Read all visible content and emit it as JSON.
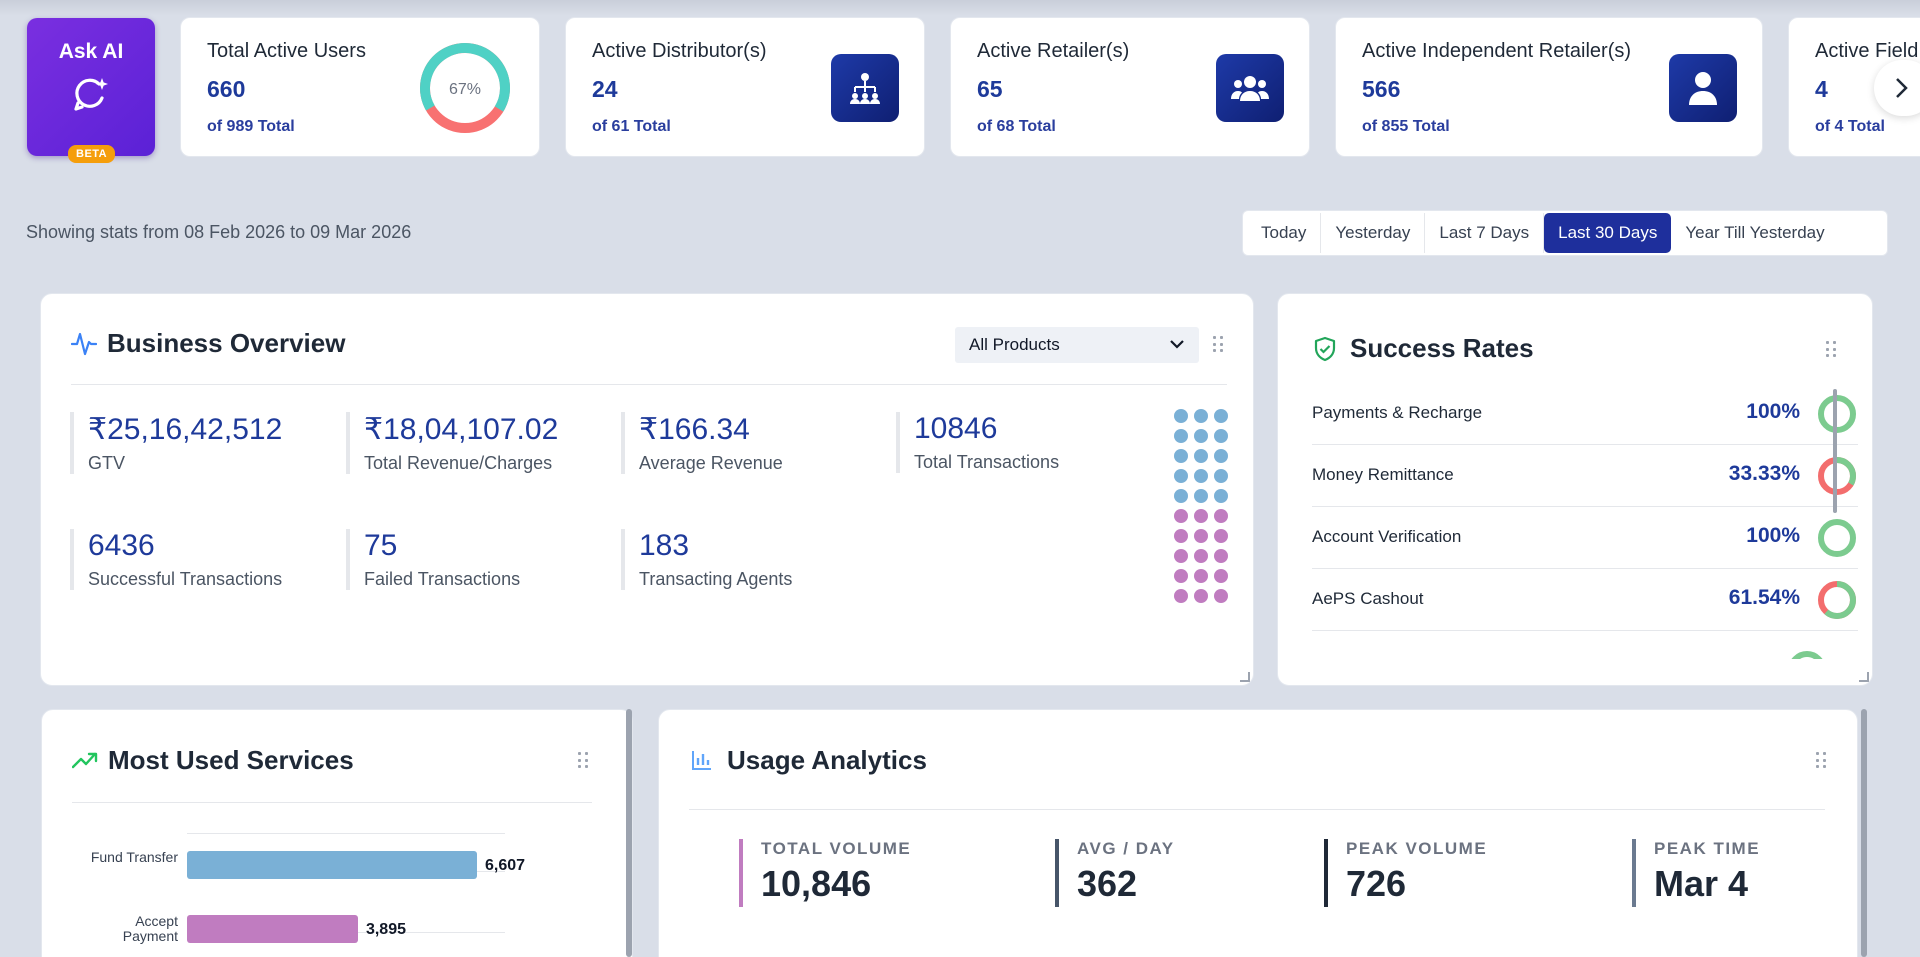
{
  "ask_ai": {
    "title": "Ask AI",
    "badge": "BETA"
  },
  "cards": [
    {
      "label": "Total Active Users",
      "value": "660",
      "sub": "of 989 Total",
      "percent": "67%",
      "fraction": 0.67,
      "icon": "donut-chart"
    },
    {
      "label": "Active Distributor(s)",
      "value": "24",
      "sub": "of 61 Total",
      "icon": "hierarchy-icon"
    },
    {
      "label": "Active Retailer(s)",
      "value": "65",
      "sub": "of 68 Total",
      "icon": "users-group-icon"
    },
    {
      "label": "Active Independent Retailer(s)",
      "value": "566",
      "sub": "of 855 Total",
      "icon": "user-icon"
    },
    {
      "label": "Active Field",
      "value": "4",
      "sub": "of 4 Total",
      "icon": "none"
    }
  ],
  "range": {
    "text": "Showing stats from 08 Feb 2026 to 09 Mar 2026",
    "tabs": [
      "Today",
      "Yesterday",
      "Last 7 Days",
      "Last 30 Days",
      "Year Till Yesterday"
    ],
    "active": "Last 30 Days"
  },
  "business_overview": {
    "title": "Business Overview",
    "product_select": "All Products",
    "metrics": [
      {
        "value": "₹25,16,42,512",
        "label": "GTV"
      },
      {
        "value": "₹18,04,107.02",
        "label": "Total Revenue/Charges"
      },
      {
        "value": "₹166.34",
        "label": "Average Revenue"
      },
      {
        "value": "10846",
        "label": "Total Transactions"
      },
      {
        "value": "6436",
        "label": "Successful Transactions"
      },
      {
        "value": "75",
        "label": "Failed Transactions"
      },
      {
        "value": "183",
        "label": "Transacting Agents"
      }
    ],
    "dot_colors": {
      "primary": "#7ab0d6",
      "secondary": "#c07cc0"
    }
  },
  "success_rates": {
    "title": "Success Rates",
    "rows": [
      {
        "label": "Payments & Recharge",
        "value": "100%",
        "fraction": 1.0
      },
      {
        "label": "Money Remittance",
        "value": "33.33%",
        "fraction": 0.3333
      },
      {
        "label": "Account Verification",
        "value": "100%",
        "fraction": 1.0
      },
      {
        "label": "AePS Cashout",
        "value": "61.54%",
        "fraction": 0.6154
      }
    ],
    "colors": {
      "success": "#7ccb8f",
      "fail": "#f36d6d"
    }
  },
  "most_used": {
    "title": "Most Used Services",
    "chart_data": {
      "type": "bar",
      "orientation": "horizontal",
      "categories": [
        "Fund Transfer",
        "Accept Payment"
      ],
      "values": [
        6607,
        3895
      ],
      "value_labels": [
        "6,607",
        "3,895"
      ],
      "colors": [
        "#7ab0d6",
        "#c07cc0"
      ]
    }
  },
  "usage_analytics": {
    "title": "Usage Analytics",
    "stats": [
      {
        "label": "TOTAL VOLUME",
        "value": "10,846",
        "color": "#c07cc0"
      },
      {
        "label": "AVG / DAY",
        "value": "362",
        "color": "#475569"
      },
      {
        "label": "PEAK VOLUME",
        "value": "726",
        "color": "#1f2937"
      },
      {
        "label": "PEAK TIME",
        "value": "Mar 4",
        "color": "#6b7a90"
      }
    ]
  }
}
